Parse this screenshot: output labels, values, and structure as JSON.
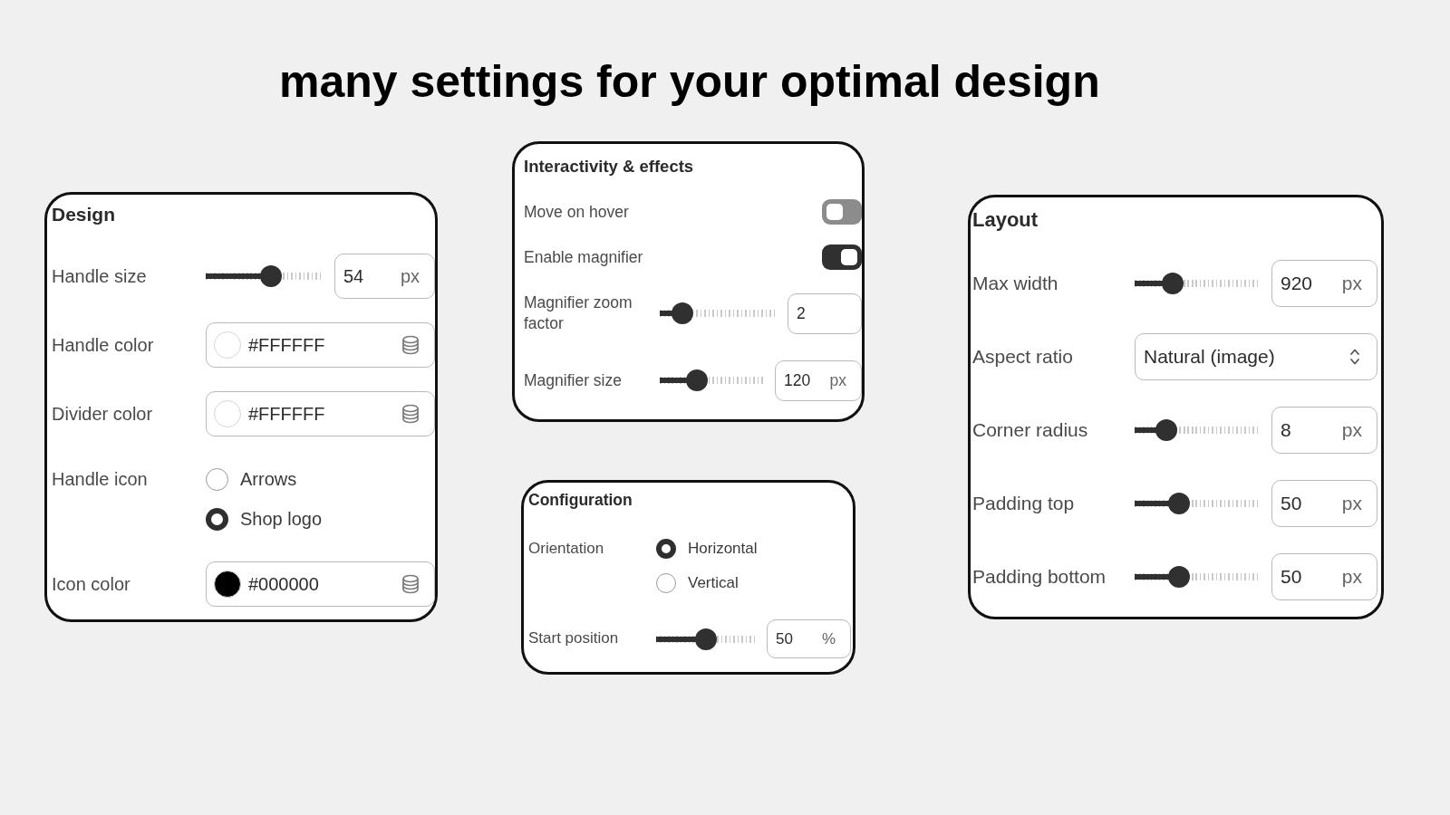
{
  "title": "many settings for your optimal design",
  "panels": [
    {
      "title": "Design",
      "rows": [
        {
          "kind": "slider",
          "label": "Handle size",
          "level": 0.55,
          "value": "54",
          "unit": "px"
        },
        {
          "kind": "color",
          "label": "Handle color",
          "value": "#FFFFFF",
          "color": "#ffffff"
        },
        {
          "kind": "color",
          "label": "Divider color",
          "value": "#FFFFFF",
          "color": "#ffffff"
        },
        {
          "kind": "radio",
          "label": "Handle icon",
          "options": [
            {
              "label": "Arrows",
              "selected": false
            },
            {
              "label": "Shop logo",
              "selected": true
            }
          ]
        },
        {
          "kind": "color",
          "label": "Icon color",
          "value": "#000000",
          "color": "#000000"
        }
      ]
    },
    {
      "title": "Interactivity & effects",
      "rows": [
        {
          "kind": "toggle",
          "label": "Move on hover",
          "on": false
        },
        {
          "kind": "toggle",
          "label": "Enable magnifier",
          "on": true
        },
        {
          "kind": "slider",
          "label": "Magnifier zoom factor",
          "level": 0.19,
          "value": "2"
        },
        {
          "kind": "slider",
          "label": "Magnifier size",
          "level": 0.36,
          "value": "120",
          "unit": "px"
        }
      ]
    },
    {
      "title": "Configuration",
      "rows": [
        {
          "kind": "radio",
          "label": "Orientation",
          "options": [
            {
              "label": "Horizontal",
              "selected": true
            },
            {
              "label": "Vertical",
              "selected": false
            }
          ]
        },
        {
          "kind": "slider",
          "label": "Start position",
          "level": 0.5,
          "value": "50",
          "unit": "%"
        }
      ]
    },
    {
      "title": "Layout",
      "rows": [
        {
          "kind": "slider",
          "label": "Max width",
          "level": 0.3,
          "value": "920",
          "unit": "px"
        },
        {
          "kind": "select",
          "label": "Aspect ratio",
          "value": "Natural (image)"
        },
        {
          "kind": "slider",
          "label": "Corner radius",
          "level": 0.25,
          "value": "8",
          "unit": "px"
        },
        {
          "kind": "slider",
          "label": "Padding top",
          "level": 0.35,
          "value": "50",
          "unit": "px"
        },
        {
          "kind": "slider",
          "label": "Padding bottom",
          "level": 0.35,
          "value": "50",
          "unit": "px"
        }
      ]
    }
  ]
}
